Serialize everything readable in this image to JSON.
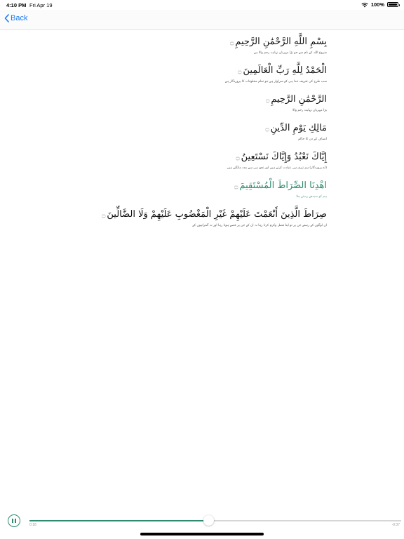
{
  "status_bar": {
    "time": "4:10 PM",
    "date": "Fri Apr 19",
    "battery": "100%",
    "wifi_icon": "wifi-icon",
    "battery_icon": "battery-icon"
  },
  "nav": {
    "back_label": "Back",
    "back_icon": "chevron-left-icon",
    "accent_color": "#1a7cf4"
  },
  "verses": [
    {
      "arabic": "بِسْمِ اللَّهِ الرَّحْمَٰنِ الرَّحِيمِ",
      "mark": "۝",
      "translation": "شروع اللہ کے نام سے جو بڑا مہربان نہایت رحم والا ہے",
      "active": false
    },
    {
      "arabic": "الْحَمْدُ لِلَّهِ رَبِّ الْعَالَمِينَ",
      "mark": "۝",
      "translation": "سب طرح کی تعریف خدا ہی کو سزاوار ہے جو تمام مخلوقات کا پروردگار ہے",
      "active": false
    },
    {
      "arabic": "الرَّحْمَٰنِ الرَّحِيمِ",
      "mark": "۝",
      "translation": "بڑا مہربان نہایت رحم والا",
      "active": false
    },
    {
      "arabic": "مَالِكِ يَوْمِ الدِّينِ",
      "mark": "۝",
      "translation": "انصاف کے دن کا حاکم",
      "active": false
    },
    {
      "arabic": "إِيَّاكَ نَعْبُدُ وَإِيَّاكَ نَسْتَعِينُ",
      "mark": "۝",
      "translation": "(اے پروردگار) ہم تیری ہی عبادت کرتے ہیں اور تجھ ہی سے مدد مانگتے ہیں",
      "active": false
    },
    {
      "arabic": "اهْدِنَا الصِّرَاطَ الْمُسْتَقِيمَ",
      "mark": "۝",
      "translation": "ہم کو سیدھے رستے چلا",
      "active": true
    },
    {
      "arabic": "صِرَاطَ الَّذِينَ أَنْعَمْتَ عَلَيْهِمْ غَيْرِ الْمَغْضُوبِ عَلَيْهِمْ وَلَا الضَّالِّينَ",
      "mark": "۝",
      "translation": "ان لوگوں کے رستے جن پر تو اپنا فضل وکرم کرتا رہا نہ ان کے جن پر غصے ہوتا رہا اور نہ گمراہوں کے",
      "active": false
    }
  ],
  "player": {
    "pause_icon": "pause-icon",
    "elapsed": "0:18",
    "remaining": "-0:37",
    "progress": 0.483,
    "accent_color": "#2e8b6f"
  }
}
